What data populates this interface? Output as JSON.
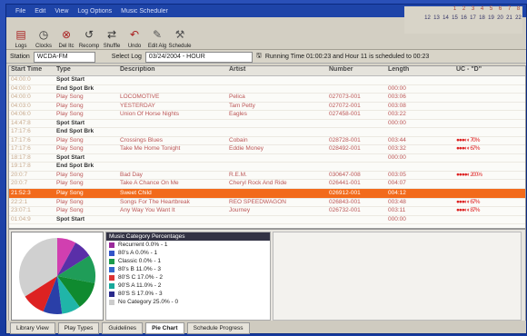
{
  "menubar": [
    "File",
    "Edit",
    "View",
    "Log Options",
    "Music Scheduler"
  ],
  "toolbar": [
    {
      "label": "Logs",
      "icon": "log-icon"
    },
    {
      "label": "Clocks",
      "icon": "clock-icon"
    },
    {
      "label": "Del Itc",
      "icon": "delete-icon"
    },
    {
      "label": "Recomp",
      "icon": "recompile-icon"
    },
    {
      "label": "Shuffle",
      "icon": "shuffle-icon"
    },
    {
      "label": "Undo",
      "icon": "undo-icon"
    },
    {
      "label": "Edit Alg",
      "icon": "edit-icon"
    },
    {
      "label": "Schedule",
      "icon": "hammer-icon"
    }
  ],
  "calendar": {
    "row1": [
      "1",
      "2",
      "3",
      "4",
      "5",
      "6",
      "7",
      "8"
    ],
    "row2": [
      "12",
      "13",
      "14",
      "15",
      "16",
      "17",
      "18",
      "19",
      "20",
      "21",
      "22"
    ]
  },
  "selectbar": {
    "station": "WCDA-FM",
    "select_log_label": "Select Log",
    "log_value": "03/24/2004 - HOUR",
    "running_time": "Running Time 01:00:23  and Hour 11 is scheduled to 00:23"
  },
  "grid": {
    "columns": [
      "Start Time",
      "Type",
      "Description",
      "Artist",
      "Number",
      "Length",
      "UC - \"D\""
    ],
    "rows": [
      {
        "time": "04:00:0",
        "type": "Spot Start",
        "desc": "",
        "artist": "",
        "num": "",
        "len": "",
        "uc": "",
        "spot": true
      },
      {
        "time": "04:00:0",
        "type": "End Spot Brk",
        "desc": "",
        "artist": "",
        "num": "",
        "len": "000:00",
        "uc": "",
        "spot": true
      },
      {
        "time": "04:00:0",
        "type": "Play Song",
        "desc": "LOCOMOTIVE",
        "artist": "Pelica",
        "num": "027073-001",
        "len": "003:06",
        "uc": ""
      },
      {
        "time": "04:03:0",
        "type": "Play Song",
        "desc": "YESTERDAY",
        "artist": "Tam Petty",
        "num": "027072-001",
        "len": "003:08",
        "uc": ""
      },
      {
        "time": "04:06:0",
        "type": "Play Song",
        "desc": "Union Of Horse Nights",
        "artist": "Eagles",
        "num": "027458-001",
        "len": "003:22",
        "uc": ""
      },
      {
        "time": "14:47:8",
        "type": "Spot Start",
        "desc": "",
        "artist": "",
        "num": "",
        "len": "000:00",
        "uc": "",
        "spot": true
      },
      {
        "time": "17:17:6",
        "type": "End Spot Brk",
        "desc": "",
        "artist": "",
        "num": "",
        "len": "",
        "uc": "",
        "spot": true
      },
      {
        "time": "17:17:6",
        "type": "Play Song",
        "desc": "Crossings Blues",
        "artist": "Cobain",
        "num": "028728-001",
        "len": "003:44",
        "uc": "●●●◐◐ 70%"
      },
      {
        "time": "17:17:6",
        "type": "Play Song",
        "desc": "Take Me Home Tonight",
        "artist": "Eddie Money",
        "num": "028492-001",
        "len": "003:32",
        "uc": "●●●◐◐ 67%"
      },
      {
        "time": "18:17:8",
        "type": "Spot Start",
        "desc": "",
        "artist": "",
        "num": "",
        "len": "000:00",
        "uc": "",
        "spot": true
      },
      {
        "time": "19:17:8",
        "type": "End Spot Brk",
        "desc": "",
        "artist": "",
        "num": "",
        "len": "",
        "uc": "",
        "spot": true
      },
      {
        "time": "20:0:7",
        "type": "Play Song",
        "desc": "Bad Day",
        "artist": "R.E.M.",
        "num": "030647-008",
        "len": "003:05",
        "uc": "●●●●◐ 200%"
      },
      {
        "time": "20:0:7",
        "type": "Play Song",
        "desc": "Take A Chance On Me",
        "artist": "Cheryl Rock And Ride",
        "num": "026441-001",
        "len": "004:07",
        "uc": ""
      },
      {
        "time": "21:52:3",
        "type": "Play Song",
        "desc": "Sweet Child",
        "artist": "",
        "num": "026912-001",
        "len": "004:12",
        "uc": "",
        "hl": true
      },
      {
        "time": "22:2:1",
        "type": "Play Song",
        "desc": "Songs For The Heartbreak",
        "artist": "REO SPEEDWAGON",
        "num": "026843-001",
        "len": "003:48",
        "uc": "●●●◐◐ 67%"
      },
      {
        "time": "23:07:1",
        "type": "Play Song",
        "desc": "Any Way You Want It",
        "artist": "Journey",
        "num": "026732-001",
        "len": "003:11",
        "uc": "●●●◐◐ 87%"
      },
      {
        "time": "01:04:9",
        "type": "Spot Start",
        "desc": "",
        "artist": "",
        "num": "",
        "len": "000:00",
        "uc": "",
        "spot": true
      }
    ]
  },
  "legend": {
    "title": "Music Category Percentages",
    "items": [
      {
        "label": "Recurrent 0.0% - 1",
        "color": "#9b2b9b"
      },
      {
        "label": "80's A  0.0% - 1",
        "color": "#3354c8"
      },
      {
        "label": "Classic  0.0% - 1",
        "color": "#1b9a4a"
      },
      {
        "label": "80's B  11.0% - 3",
        "color": "#36c"
      },
      {
        "label": "80'S C  17.0% - 2",
        "color": "#d33"
      },
      {
        "label": "90'S A  11.0% - 2",
        "color": "#18a89a"
      },
      {
        "label": "80'S S  17.0% - 3",
        "color": "#2b2b8c"
      },
      {
        "label": "No Category 25.0% - 0",
        "color": "#ccc"
      }
    ]
  },
  "pie_slices": [
    {
      "value": 0.08,
      "color": "#d13fb0"
    },
    {
      "value": 0.08,
      "color": "#5a2fa8"
    },
    {
      "value": 0.12,
      "color": "#1f9d58"
    },
    {
      "value": 0.12,
      "color": "#0f8a2f"
    },
    {
      "value": 0.08,
      "color": "#20b5a8"
    },
    {
      "value": 0.08,
      "color": "#2a3fa8"
    },
    {
      "value": 0.1,
      "color": "#d22"
    },
    {
      "value": 0.34,
      "color": "#d0d0d0"
    }
  ],
  "tabs": [
    "Library View",
    "Play Types",
    "Guidelines",
    "Pie Chart",
    "Schedule Progress"
  ],
  "active_tab": 3
}
